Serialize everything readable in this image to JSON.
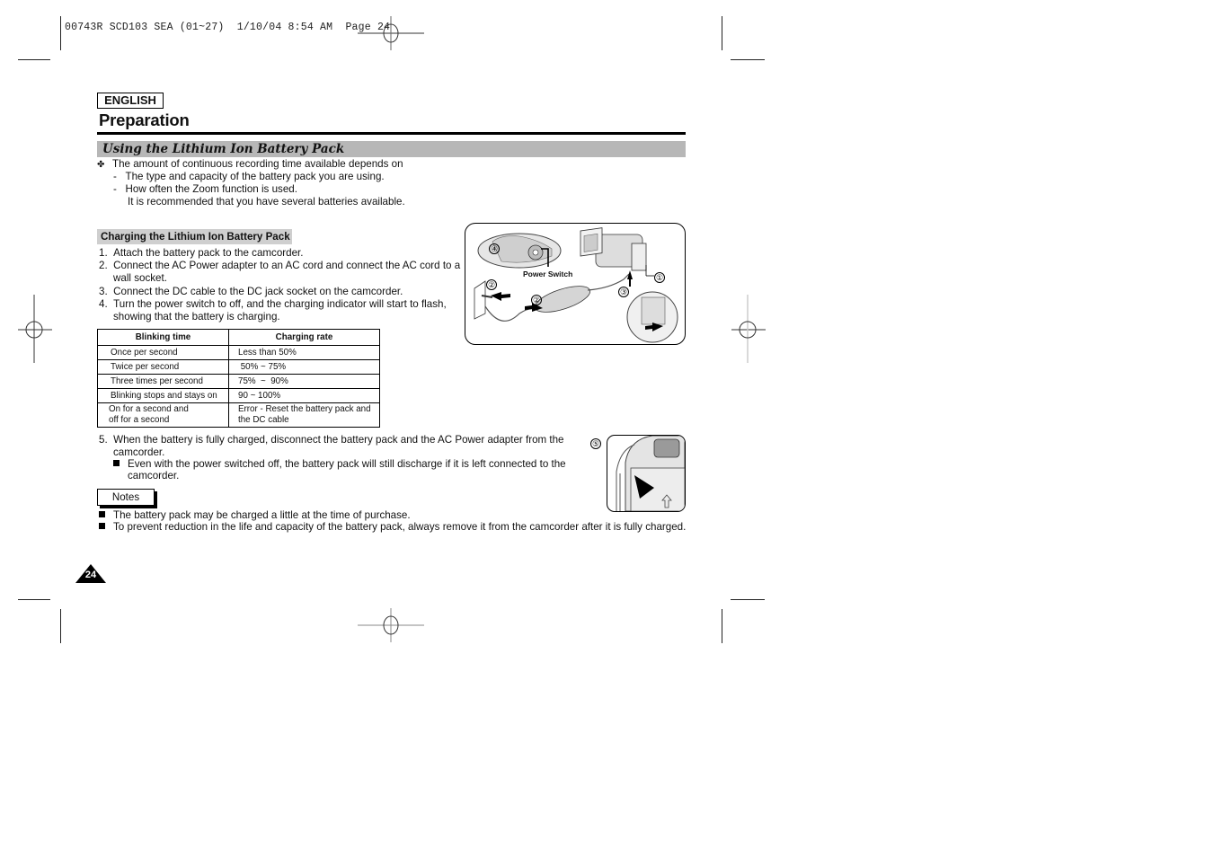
{
  "slug_line": "00743R SCD103 SEA (01~27)  1/10/04 8:54 AM  Page 24",
  "language_label": "ENGLISH",
  "page_title": "Preparation",
  "section_title": "Using the Lithium Ion Battery Pack",
  "intro": {
    "bullet_symbol": "✤",
    "lead": "The amount of continuous recording time available depends on",
    "items": [
      "The type and capacity of the battery pack you are using.",
      "How often the Zoom function is used."
    ],
    "recommendation": "It is recommended that you have several batteries available."
  },
  "charging": {
    "title": "Charging the Lithium Ion Battery Pack",
    "steps": [
      {
        "num": "1.",
        "lines": [
          "Attach the battery pack to the camcorder."
        ]
      },
      {
        "num": "2.",
        "lines": [
          "Connect the AC Power adapter to an AC cord and connect the AC cord to a",
          "wall socket."
        ]
      },
      {
        "num": "3.",
        "lines": [
          "Connect the DC cable to the DC jack socket on the camcorder."
        ]
      },
      {
        "num": "4.",
        "lines": [
          "Turn the power switch to off, and the charging indicator will start to flash,",
          "showing that the battery is charging."
        ]
      }
    ],
    "table": {
      "headers": [
        "Blinking time",
        "Charging rate"
      ],
      "rows": [
        [
          "Once per second",
          "Less than 50%"
        ],
        [
          "Twice per second",
          " 50% ~ 75%"
        ],
        [
          "Three times per second",
          "75%  ~  90%"
        ],
        [
          "Blinking stops and stays on",
          "90 ~ 100%"
        ],
        [
          "On for a second and\noff for a second",
          "Error - Reset the battery pack and\nthe DC cable"
        ]
      ]
    },
    "step5": {
      "num": "5.",
      "lines": [
        "When the battery is fully charged, disconnect the battery pack and the AC Power adapter from the",
        "camcorder."
      ],
      "sub_note": [
        "Even with the power switched off, the battery pack will still discharge if it is left connected to the",
        "camcorder."
      ]
    }
  },
  "figure1": {
    "label_power_switch": "Power Switch",
    "callouts": [
      "①",
      "②",
      "②",
      "③",
      "④"
    ]
  },
  "figure2": {
    "callout": "⑤"
  },
  "notes": {
    "label": "Notes",
    "items": [
      "The battery pack may be charged a little at the time of purchase.",
      "To prevent reduction in the life and capacity of the battery pack, always remove it from the camcorder after it is fully charged."
    ]
  },
  "page_number": "24"
}
